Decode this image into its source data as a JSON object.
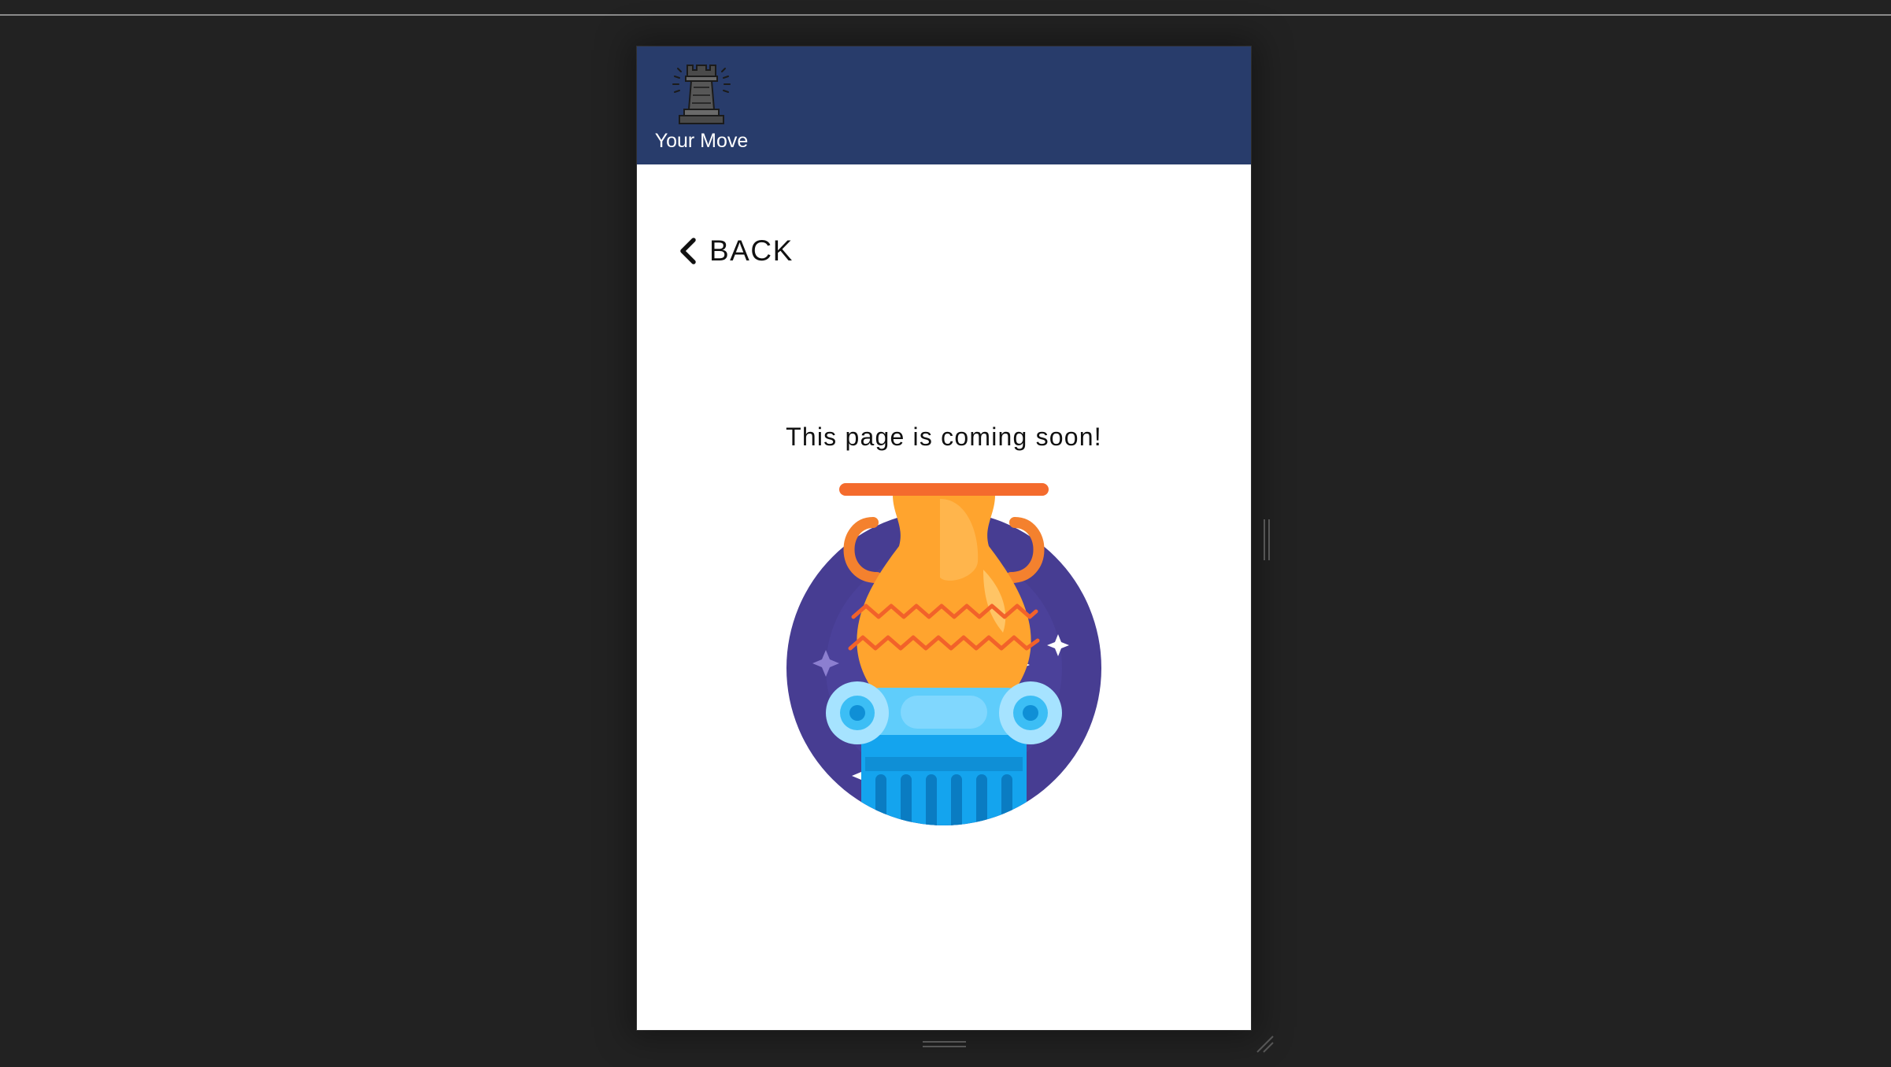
{
  "app": {
    "brand_name": "Your Move",
    "logo_icon": "chess-rook-icon"
  },
  "nav": {
    "back_label": "BACK",
    "back_icon": "chevron-left-icon"
  },
  "main": {
    "message": "This page is coming soon!",
    "illustration_icon": "amphora-on-column-icon"
  },
  "colors": {
    "header_bg": "#283c6b",
    "page_bg": "#ffffff",
    "backdrop": "#222222",
    "circle": "#473d92",
    "vase": "#ffa42e",
    "vase_lip": "#f46b2d",
    "zigzag": "#f2622a",
    "column": "#14a4ee",
    "column_light": "#5fcdfb"
  }
}
